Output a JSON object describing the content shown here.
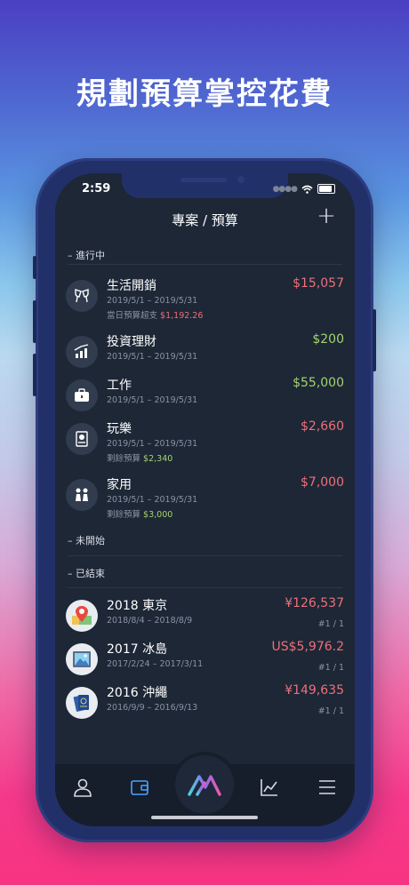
{
  "headline": "規劃預算掌控花費",
  "status_bar": {
    "time": "2:59"
  },
  "nav": {
    "title": "專案 / 預算",
    "add_label": "+"
  },
  "sections": {
    "in_progress": "– 進行中",
    "not_started": "– 未開始",
    "ended": "– 已結束"
  },
  "active_budgets": [
    {
      "name": "生活開銷",
      "dates": "2019/5/1 – 2019/5/31",
      "note_label": "當日預算超支",
      "note_value": "$1,192.26",
      "amount": "$15,057",
      "icon": "cheers-icon"
    },
    {
      "name": "投資理財",
      "dates": "2019/5/1 – 2019/5/31",
      "amount": "$200",
      "icon": "chart-bars-icon"
    },
    {
      "name": "工作",
      "dates": "2019/5/1 – 2019/5/31",
      "amount": "$55,000",
      "icon": "briefcase-icon"
    },
    {
      "name": "玩樂",
      "dates": "2019/5/1 – 2019/5/31",
      "note_label": "剩餘預算",
      "note_value": "$2,340",
      "amount": "$2,660",
      "icon": "ticket-icon"
    },
    {
      "name": "家用",
      "dates": "2019/5/1 – 2019/5/31",
      "note_label": "剩餘預算",
      "note_value": "$3,000",
      "amount": "$7,000",
      "icon": "family-icon"
    }
  ],
  "ended_trips": [
    {
      "name": "2018 東京",
      "dates": "2018/8/4 – 2018/8/9",
      "amount": "¥126,537",
      "page": "#1 / 1",
      "icon": "map-pin-icon"
    },
    {
      "name": "2017 冰島",
      "dates": "2017/2/24 – 2017/3/11",
      "amount": "US$5,976.2",
      "page": "#1 / 1",
      "icon": "picture-icon"
    },
    {
      "name": "2016 沖繩",
      "dates": "2016/9/9 – 2016/9/13",
      "amount": "¥149,635",
      "page": "#1 / 1",
      "icon": "passport-icon"
    }
  ],
  "colors": {
    "expense": "#ee6f7a",
    "income": "#a3d36f",
    "screen_bg": "#1d2736"
  },
  "tabbar": [
    "profile-icon",
    "wallet-icon",
    "logo-icon",
    "chart-line-icon",
    "menu-icon"
  ]
}
